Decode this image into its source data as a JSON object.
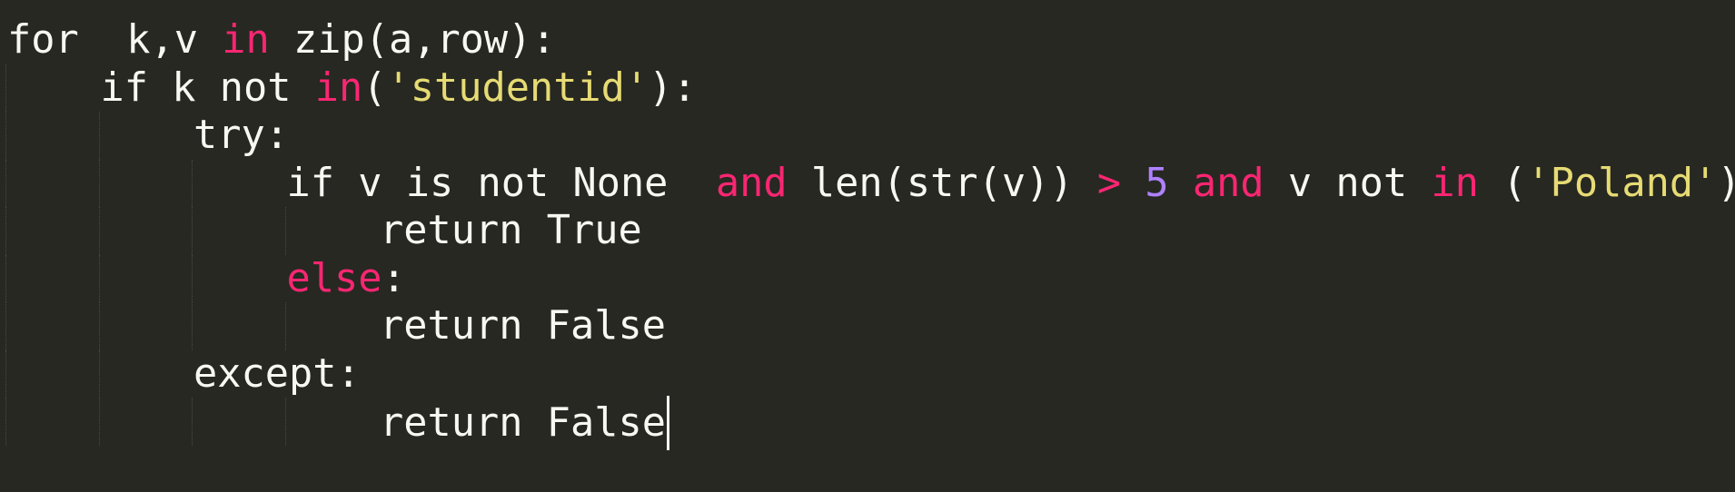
{
  "editor": {
    "theme_colors": {
      "background": "#272822",
      "foreground": "#f8f8f2",
      "keyword": "#f92672",
      "string": "#e6db74",
      "number": "#ae81ff"
    },
    "lines": [
      {
        "indent": 0,
        "tokens": [
          {
            "t": "for  k,v ",
            "c": "plain"
          },
          {
            "t": "in",
            "c": "kw"
          },
          {
            "t": " zip(a,row):",
            "c": "plain"
          }
        ]
      },
      {
        "indent": 1,
        "tokens": [
          {
            "t": "if k not ",
            "c": "plain"
          },
          {
            "t": "in",
            "c": "kw"
          },
          {
            "t": "(",
            "c": "plain"
          },
          {
            "t": "'studentid'",
            "c": "str"
          },
          {
            "t": "):",
            "c": "plain"
          }
        ]
      },
      {
        "indent": 2,
        "tokens": [
          {
            "t": "try:",
            "c": "plain"
          }
        ]
      },
      {
        "indent": 3,
        "tokens": [
          {
            "t": "if v is not None  ",
            "c": "plain"
          },
          {
            "t": "and",
            "c": "kw"
          },
          {
            "t": " len(str(v)) ",
            "c": "plain"
          },
          {
            "t": ">",
            "c": "kw"
          },
          {
            "t": " ",
            "c": "plain"
          },
          {
            "t": "5",
            "c": "num"
          },
          {
            "t": " ",
            "c": "plain"
          },
          {
            "t": "and",
            "c": "kw"
          },
          {
            "t": " v not ",
            "c": "plain"
          },
          {
            "t": "in",
            "c": "kw"
          },
          {
            "t": " (",
            "c": "plain"
          },
          {
            "t": "'Poland'",
            "c": "str"
          },
          {
            "t": "):",
            "c": "plain"
          }
        ]
      },
      {
        "indent": 4,
        "tokens": [
          {
            "t": "return True",
            "c": "plain"
          }
        ]
      },
      {
        "indent": 3,
        "tokens": [
          {
            "t": "else",
            "c": "kw"
          },
          {
            "t": ":",
            "c": "plain"
          }
        ]
      },
      {
        "indent": 4,
        "tokens": [
          {
            "t": "return False",
            "c": "plain"
          }
        ]
      },
      {
        "indent": 2,
        "tokens": [
          {
            "t": "except:",
            "c": "plain"
          }
        ]
      },
      {
        "indent": 4,
        "tokens": [
          {
            "t": "return False",
            "c": "plain"
          }
        ],
        "cursor_at_end": true
      }
    ]
  }
}
